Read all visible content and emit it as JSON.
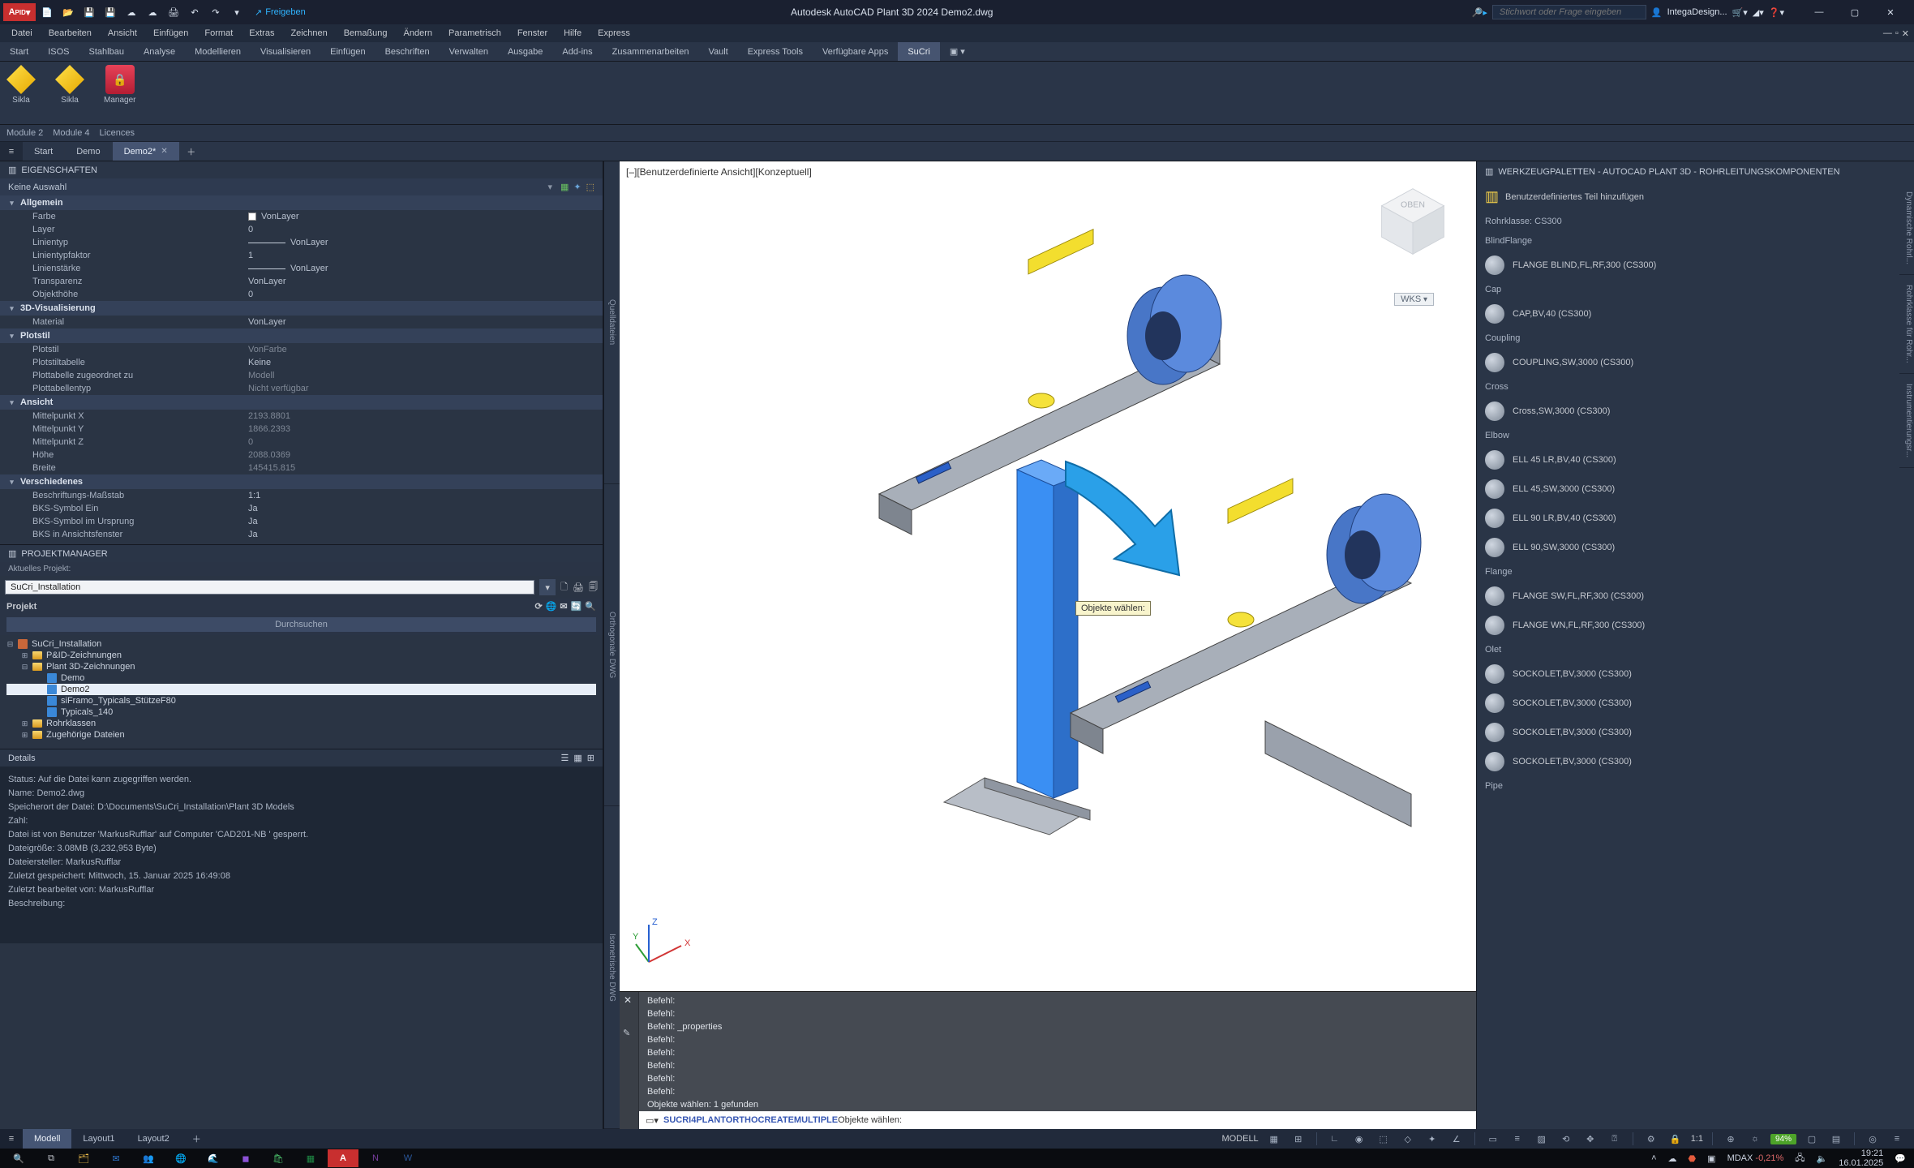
{
  "titlebar": {
    "share": "Freigeben",
    "center": "Autodesk AutoCAD Plant 3D 2024   Demo2.dwg",
    "search_placeholder": "Stichwort oder Frage eingeben",
    "user": "IntegaDesign..."
  },
  "menubar": [
    "Datei",
    "Bearbeiten",
    "Ansicht",
    "Einfügen",
    "Format",
    "Extras",
    "Zeichnen",
    "Bemaßung",
    "Ändern",
    "Parametrisch",
    "Fenster",
    "Hilfe",
    "Express"
  ],
  "ribbon": {
    "tabs": [
      "Start",
      "ISOS",
      "Stahlbau",
      "Analyse",
      "Modellieren",
      "Visualisieren",
      "Einfügen",
      "Beschriften",
      "Verwalten",
      "Ausgabe",
      "Add-ins",
      "Zusammenarbeiten",
      "Vault",
      "Express Tools",
      "Verfügbare Apps",
      "SuCri"
    ],
    "active": "SuCri",
    "items": [
      {
        "label": "Sikla"
      },
      {
        "label": "Sikla"
      },
      {
        "label": "Manager"
      }
    ]
  },
  "module_strip": [
    "Module 2",
    "Module 4",
    "Licences"
  ],
  "filetabs": {
    "items": [
      "Start",
      "Demo",
      "Demo2*"
    ],
    "active": "Demo2*"
  },
  "props": {
    "title": "EIGENSCHAFTEN",
    "selection": "Keine Auswahl",
    "rows": [
      {
        "cat": "Allgemein"
      },
      {
        "l": "Farbe",
        "v": "VonLayer",
        "swatch": true
      },
      {
        "l": "Layer",
        "v": "0"
      },
      {
        "l": "Linientyp",
        "v": "VonLayer",
        "line": true
      },
      {
        "l": "Linientypfaktor",
        "v": "1"
      },
      {
        "l": "Linienstärke",
        "v": "VonLayer",
        "line": true
      },
      {
        "l": "Transparenz",
        "v": "VonLayer"
      },
      {
        "l": "Objekthöhe",
        "v": "0"
      },
      {
        "cat": "3D-Visualisierung"
      },
      {
        "l": "Material",
        "v": "VonLayer"
      },
      {
        "cat": "Plotstil"
      },
      {
        "l": "Plotstil",
        "v": "VonFarbe",
        "dim": true
      },
      {
        "l": "Plotstiltabelle",
        "v": "Keine"
      },
      {
        "l": "Plottabelle zugeordnet zu",
        "v": "Modell",
        "dim": true
      },
      {
        "l": "Plottabellentyp",
        "v": "Nicht verfügbar",
        "dim": true
      },
      {
        "cat": "Ansicht"
      },
      {
        "l": "Mittelpunkt X",
        "v": "2193.8801",
        "dim": true
      },
      {
        "l": "Mittelpunkt Y",
        "v": "1866.2393",
        "dim": true
      },
      {
        "l": "Mittelpunkt Z",
        "v": "0",
        "dim": true
      },
      {
        "l": "Höhe",
        "v": "2088.0369",
        "dim": true
      },
      {
        "l": "Breite",
        "v": "145415.815",
        "dim": true
      },
      {
        "cat": "Verschiedenes"
      },
      {
        "l": "Beschriftungs-Maßstab",
        "v": "1:1"
      },
      {
        "l": "BKS-Symbol Ein",
        "v": "Ja"
      },
      {
        "l": "BKS-Symbol im Ursprung",
        "v": "Ja"
      },
      {
        "l": "BKS in Ansichtsfenster",
        "v": "Ja"
      }
    ]
  },
  "pm": {
    "title": "PROJEKTMANAGER",
    "current_label": "Aktuelles Projekt:",
    "current": "SuCri_Installation",
    "tab": "Projekt",
    "search": "Durchsuchen",
    "tree": [
      {
        "lvl": 0,
        "t": "SuCri_Installation",
        "exp": "-",
        "ic": "book"
      },
      {
        "lvl": 1,
        "t": "P&ID-Zeichnungen",
        "exp": "+",
        "ic": "folder"
      },
      {
        "lvl": 1,
        "t": "Plant 3D-Zeichnungen",
        "exp": "-",
        "ic": "folder"
      },
      {
        "lvl": 2,
        "t": "Demo",
        "ic": "dwg"
      },
      {
        "lvl": 2,
        "t": "Demo2",
        "ic": "dwg",
        "sel": true
      },
      {
        "lvl": 2,
        "t": "siFramo_Typicals_StützeF80",
        "ic": "dwg"
      },
      {
        "lvl": 2,
        "t": "Typicals_140",
        "ic": "dwg"
      },
      {
        "lvl": 1,
        "t": "Rohrklassen",
        "exp": "+",
        "ic": "folder"
      },
      {
        "lvl": 1,
        "t": "Zugehörige Dateien",
        "exp": "+",
        "ic": "folder"
      }
    ]
  },
  "details": {
    "title": "Details",
    "lines": [
      "Status: Auf die Datei kann zugegriffen werden.",
      "Name: Demo2.dwg",
      "Speicherort der Datei: D:\\Documents\\SuCri_Installation\\Plant 3D Models",
      "Zahl:",
      "Datei ist von Benutzer 'MarkusRufflar' auf Computer 'CAD201-NB ' gesperrt.",
      "Dateigröße: 3.08MB (3,232,953 Byte)",
      "Dateiersteller: MarkusRufflar",
      "Zuletzt gespeichert: Mittwoch, 15. Januar 2025 16:49:08",
      "Zuletzt bearbeitet von: MarkusRufflar",
      "Beschreibung:"
    ]
  },
  "viewport": {
    "label": "[–][Benutzerdefinierte Ansicht][Konzeptuell]",
    "tooltip": "Objekte wählen:",
    "wcs": "WKS"
  },
  "cmd": {
    "lines": [
      "Befehl:",
      "Befehl:",
      "Befehl: _properties",
      "Befehl:",
      "Befehl:",
      "Befehl:",
      "Befehl:",
      "Befehl:",
      "Objekte wählen: 1 gefunden"
    ],
    "prompt_command": "SUCRI4PLANTORTHOCREATEMULTIPLE",
    "prompt_tail": " Objekte wählen:"
  },
  "tools": {
    "title": "WERKZEUGPALETTEN - AUTOCAD PLANT 3D - ROHRLEITUNGSKOMPONENTEN",
    "add": "Benutzerdefiniertes Teil hinzufügen",
    "sections": [
      {
        "h": "Rohrklasse: CS300",
        "items": []
      },
      {
        "h": "BlindFlange",
        "items": [
          "FLANGE BLIND,FL,RF,300 (CS300)"
        ]
      },
      {
        "h": "Cap",
        "items": [
          "CAP,BV,40 (CS300)"
        ]
      },
      {
        "h": "Coupling",
        "items": [
          "COUPLING,SW,3000 (CS300)"
        ]
      },
      {
        "h": "Cross",
        "items": [
          "Cross,SW,3000 (CS300)"
        ]
      },
      {
        "h": "Elbow",
        "items": [
          "ELL 45 LR,BV,40 (CS300)",
          "ELL 45,SW,3000 (CS300)",
          "ELL 90 LR,BV,40 (CS300)",
          "ELL 90,SW,3000 (CS300)"
        ]
      },
      {
        "h": "Flange",
        "items": [
          "FLANGE SW,FL,RF,300 (CS300)",
          "FLANGE WN,FL,RF,300 (CS300)"
        ]
      },
      {
        "h": "Olet",
        "items": [
          "SOCKOLET,BV,3000 (CS300)",
          "SOCKOLET,BV,3000 (CS300)",
          "SOCKOLET,BV,3000 (CS300)",
          "SOCKOLET,BV,3000 (CS300)"
        ]
      },
      {
        "h": "Pipe",
        "items": []
      }
    ],
    "sidetabs": [
      "Dynamische Rohrl...",
      "Rohrklasse für Rohr...",
      "Instrumentierungsr..."
    ]
  },
  "sidetabs_left": [
    "Quelldateien",
    "Orthogonale DWG",
    "Isometrische DWG"
  ],
  "bottom": {
    "tabs": [
      "Modell",
      "Layout1",
      "Layout2"
    ],
    "active": "Modell",
    "modelltxt": "MODELL",
    "scale": "1:1",
    "zoom": "94%"
  },
  "taskbar": {
    "tray": {
      "mdax_label": "MDAX",
      "mdax_val": "-0,21%",
      "time": "19:21",
      "date": "16.01.2025"
    }
  }
}
